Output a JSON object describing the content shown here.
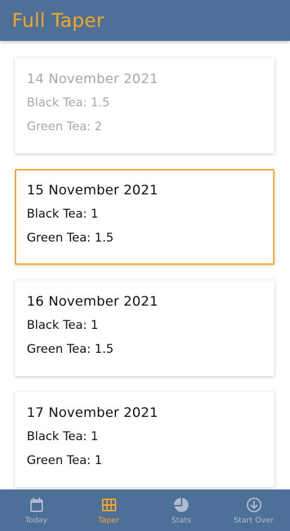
{
  "app": {
    "title": "Full Taper",
    "colors": {
      "accent": "#f5a623",
      "bar": "#4d7099",
      "inactive_nav": "#aebccd",
      "past_text": "#a8a8a8"
    }
  },
  "days": [
    {
      "date": "14 November 2021",
      "state": "past",
      "items": [
        {
          "label": "Black Tea",
          "sep": ": ",
          "amount": "1.5"
        },
        {
          "label": "Green Tea",
          "sep": ": ",
          "amount": "2"
        }
      ]
    },
    {
      "date": "15 November 2021",
      "state": "selected",
      "items": [
        {
          "label": "Black Tea",
          "sep": ": ",
          "amount": "1"
        },
        {
          "label": "Green Tea",
          "sep": ": ",
          "amount": "1.5"
        }
      ]
    },
    {
      "date": "16 November 2021",
      "state": "upcoming",
      "items": [
        {
          "label": "Black Tea",
          "sep": ": ",
          "amount": "1"
        },
        {
          "label": "Green Tea",
          "sep": ": ",
          "amount": "1.5"
        }
      ]
    },
    {
      "date": "17 November 2021",
      "state": "upcoming",
      "items": [
        {
          "label": "Black Tea",
          "sep": ": ",
          "amount": "1"
        },
        {
          "label": "Green Tea",
          "sep": ": ",
          "amount": "1"
        }
      ]
    }
  ],
  "nav": {
    "items": [
      {
        "label": "Today",
        "icon": "calendar-icon",
        "active": false
      },
      {
        "label": "Taper",
        "icon": "grid-icon",
        "active": true
      },
      {
        "label": "Stats",
        "icon": "pie-chart-icon",
        "active": false
      },
      {
        "label": "Start Over",
        "icon": "download-circle-icon",
        "active": false
      }
    ]
  }
}
